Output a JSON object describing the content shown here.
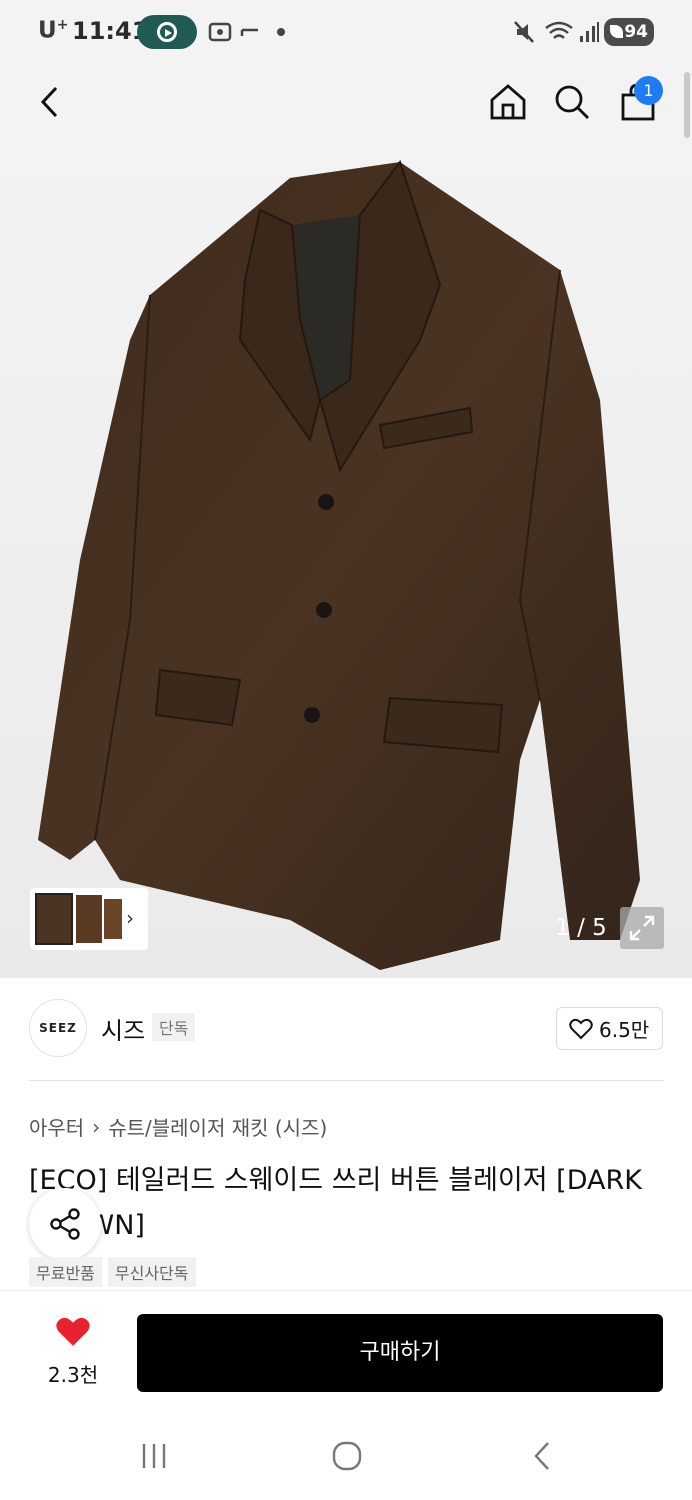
{
  "status_bar": {
    "carrier": "U",
    "carrier_sup": "+",
    "time": "11:41",
    "battery": "94"
  },
  "header": {
    "cart_count": "1"
  },
  "gallery": {
    "counter": "1 / 5"
  },
  "brand": {
    "logo_text": "SEEZ",
    "name": "시즈",
    "tag": "단독",
    "likes": "6.5만"
  },
  "breadcrumb": {
    "category": "아우터",
    "subcategory": "슈트/블레이저 재킷 (시즈)"
  },
  "product": {
    "title": "[ECO] 테일러드 스웨이드 쓰리 버튼 블레이저 [DARK BROWN]",
    "tags": [
      "무료반품",
      "무신사단독"
    ]
  },
  "bottom": {
    "wish_count": "2.3천",
    "buy_label": "구매하기"
  },
  "colors": {
    "accent_blue": "#1f7bf2",
    "wish_red": "#e8222e",
    "buy_black": "#000000"
  }
}
